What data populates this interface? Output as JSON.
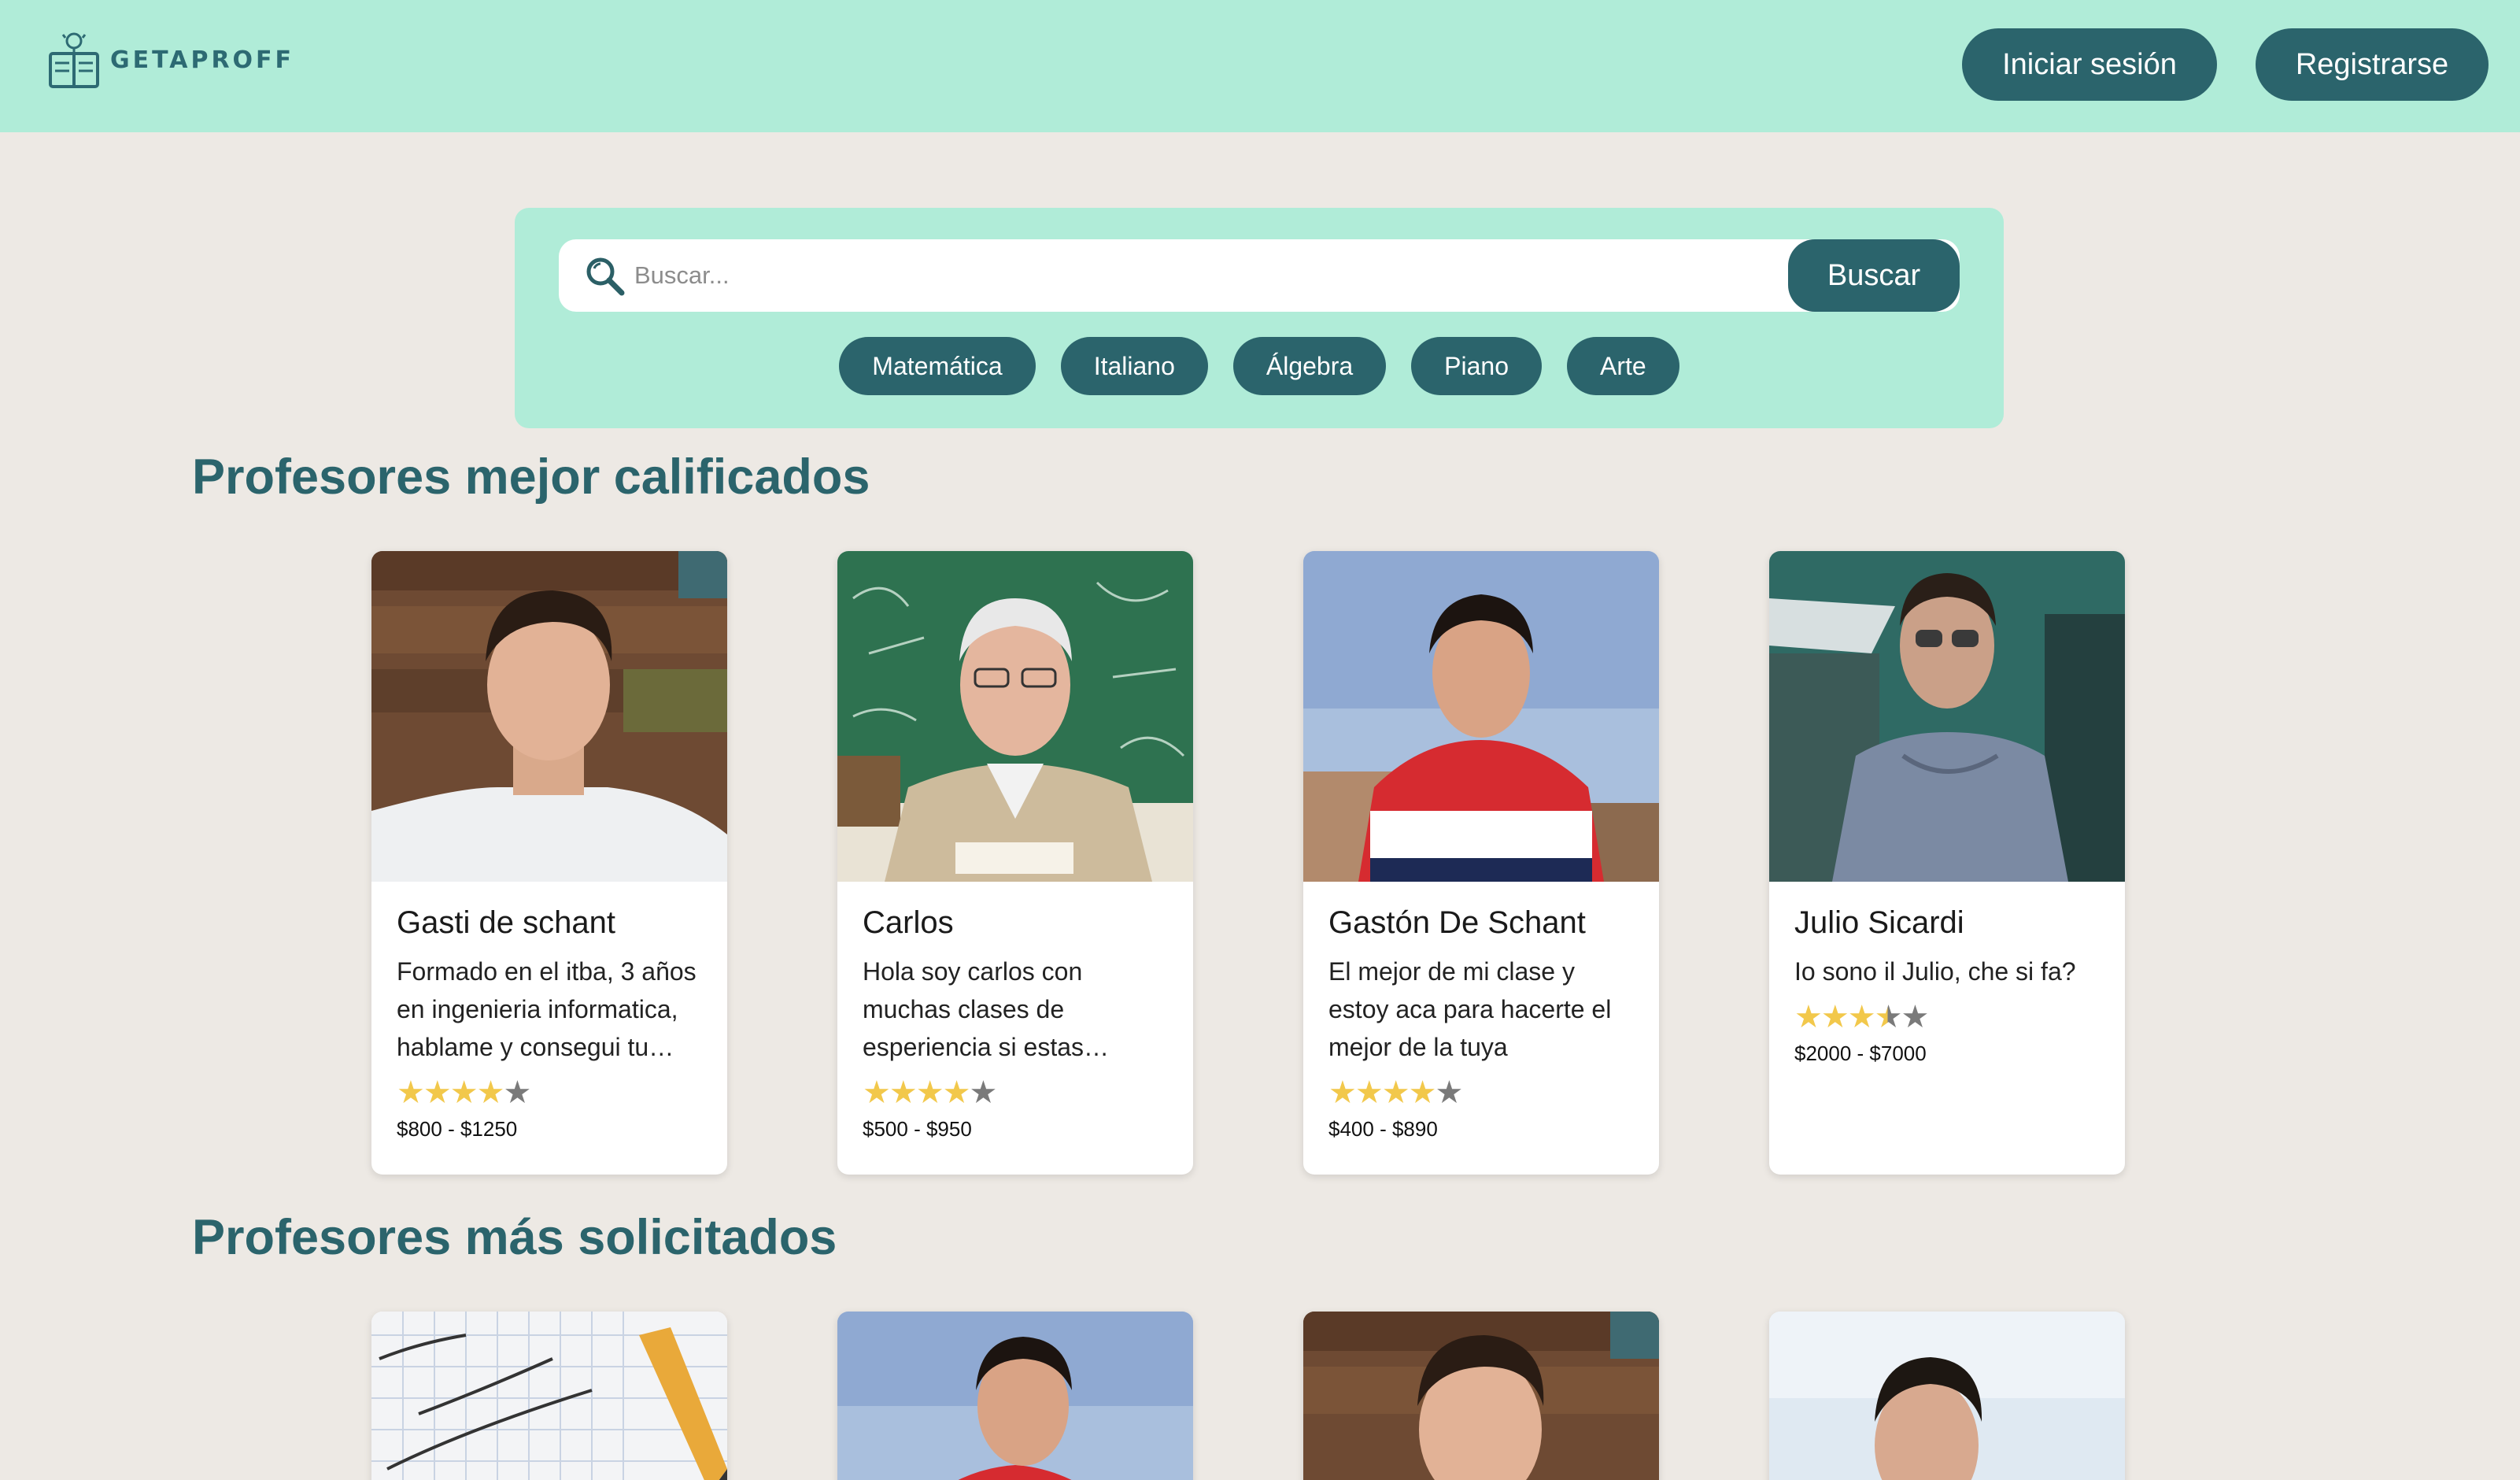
{
  "app": {
    "logo_text": "GETAPROFF"
  },
  "header": {
    "login_label": "Iniciar sesión",
    "register_label": "Registrarse"
  },
  "search": {
    "placeholder": "Buscar...",
    "button_label": "Buscar",
    "chips": [
      "Matemática",
      "Italiano",
      "Álgebra",
      "Piano",
      "Arte"
    ]
  },
  "sections": {
    "top_rated_title": "Profesores mejor calificados",
    "most_requested_title": "Profesores más solicitados"
  },
  "top_rated": [
    {
      "name": "Gasti de schant",
      "description": "Formado en el itba, 3 años en ingenieria informatica, hablame y consegui tu mejor clase",
      "rating": 4,
      "price": "$800 - $1250",
      "photo": "young-man-wood-background"
    },
    {
      "name": "Carlos",
      "description": "Hola soy carlos con muchas clases de esperiencia si estas buscando clases",
      "rating": 4,
      "price": "$500 - $950",
      "photo": "older-teacher-chalkboard"
    },
    {
      "name": "Gastón De Schant",
      "description": "El mejor de mi clase y estoy aca para hacerte el mejor de la tuya",
      "rating": 4,
      "price": "$400 - $890",
      "photo": "young-man-red-hoodie"
    },
    {
      "name": "Julio Sicardi",
      "description": "Io sono il Julio, che si fa?",
      "rating": 3.5,
      "price": "$2000 - $7000",
      "photo": "young-man-sunglasses"
    }
  ],
  "most_requested": [
    {
      "photo": "math-notebook-pencil"
    },
    {
      "photo": "young-man-red-hoodie"
    },
    {
      "photo": "young-man-wood-background"
    },
    {
      "photo": "young-man-sky"
    }
  ],
  "colors": {
    "header_bg": "#b0ecd8",
    "accent": "#2b646c",
    "page_bg": "#ede9e4",
    "star": "#f2c84b"
  }
}
